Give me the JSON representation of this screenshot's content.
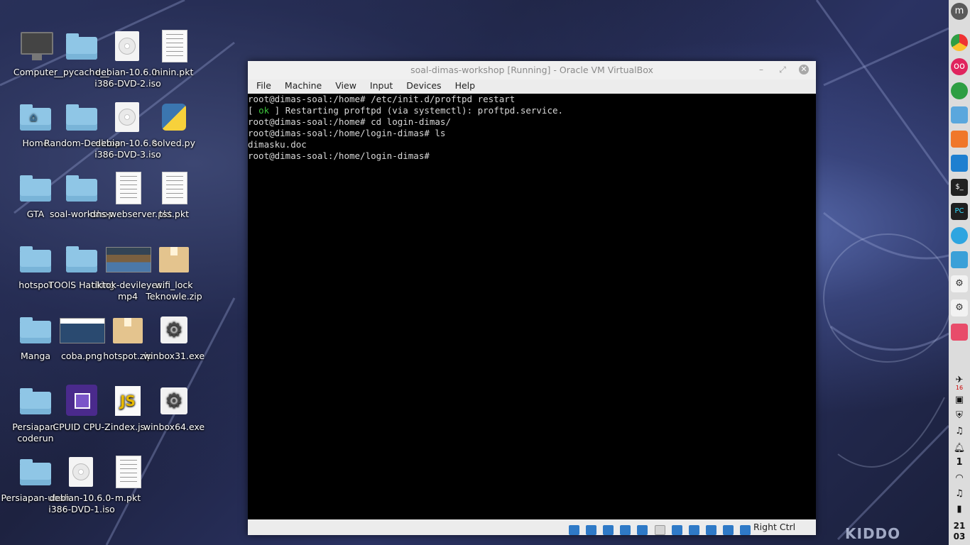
{
  "desktop": {
    "icons": [
      {
        "label": "Computer",
        "type": "computer"
      },
      {
        "label": "__pycache__",
        "type": "folder"
      },
      {
        "label": "debian-10.6.0-i386-DVD-2.iso",
        "type": "disc"
      },
      {
        "label": "ninin.pkt",
        "type": "doc"
      },
      {
        "label": "Home",
        "type": "home-folder"
      },
      {
        "label": "Random-Desktop",
        "type": "folder"
      },
      {
        "label": "debian-10.6.0-i386-DVD-3.iso",
        "type": "disc"
      },
      {
        "label": "solved.py",
        "type": "python"
      },
      {
        "label": "GTA",
        "type": "folder"
      },
      {
        "label": "soal-workshop",
        "type": "folder"
      },
      {
        "label": "dns-webserver.pkt",
        "type": "doc"
      },
      {
        "label": "tss.pkt",
        "type": "doc"
      },
      {
        "label": "hotspot",
        "type": "folder"
      },
      {
        "label": "TOOlS Hacking",
        "type": "folder"
      },
      {
        "label": "tiktok-devileyes.mp4",
        "type": "video"
      },
      {
        "label": "wifi_lock Teknowle.zip",
        "type": "zip"
      },
      {
        "label": "Manga",
        "type": "folder"
      },
      {
        "label": "coba.png",
        "type": "image"
      },
      {
        "label": "hotspot.zip",
        "type": "zip"
      },
      {
        "label": "winbox31.exe",
        "type": "exe"
      },
      {
        "label": "Persiapan-coderun",
        "type": "folder"
      },
      {
        "label": "CPUID CPU-Z",
        "type": "cpuz"
      },
      {
        "label": "index.js",
        "type": "js"
      },
      {
        "label": "winbox64.exe",
        "type": "exe"
      },
      {
        "label": "Persiapan-ubah",
        "type": "folder"
      },
      {
        "label": "debian-10.6.0-i386-DVD-1.iso",
        "type": "disc"
      },
      {
        "label": "m.pkt",
        "type": "doc"
      }
    ],
    "labels_display": {
      "computer": "Computer",
      "pycache": "__pycache__",
      "dvd2_l1": "debian-10.6.0-",
      "dvd2_l2": "i386-DVD-2.iso",
      "ninin": "ninin.pkt",
      "home": "Home",
      "random": "Random-Desktop",
      "dvd3_l1": "debian-10.6.0-",
      "dvd3_l2": "i386-DVD-3.iso",
      "solved": "solved.py",
      "gta": "GTA",
      "soal": "soal-workshop",
      "dns": "dns-webserver.pkt",
      "tss": "tss.pkt",
      "hotspot": "hotspot",
      "tools": "TOOlS Hacking",
      "tiktok_l1": "tiktok-devileyes.",
      "tiktok_l2": "mp4",
      "wifi_l1": "wifi_lock",
      "wifi_l2": "Teknowle.zip",
      "manga": "Manga",
      "coba": "coba.png",
      "hotspotzip": "hotspot.zip",
      "winbox31": "winbox31.exe",
      "coderun_l1": "Persiapan-",
      "coderun_l2": "coderun",
      "cpuz": "CPUID CPU-Z",
      "indexjs": "index.js",
      "winbox64": "winbox64.exe",
      "ubah": "Persiapan-ubah",
      "dvd1_l1": "debian-10.6.0-",
      "dvd1_l2": "i386-DVD-1.iso",
      "mpkt": "m.pkt"
    }
  },
  "window": {
    "title": "soal-dimas-workshop [Running] - Oracle VM VirtualBox",
    "controls": {
      "minimize": "–",
      "maximize": "⤢",
      "close": "✕"
    },
    "menu": [
      "File",
      "Machine",
      "View",
      "Input",
      "Devices",
      "Help"
    ],
    "terminal": {
      "lines": [
        "root@dimas-soal:/home# /etc/init.d/proftpd restart",
        "dimas-soal_ok_line",
        "root@dimas-soal:/home# cd login-dimas/",
        "root@dimas-soal:/home/login-dimas# ls",
        "dimasku.doc",
        "root@dimas-soal:/home/login-dimas# "
      ],
      "ok_prefix": "[ ",
      "ok_word": "ok",
      "ok_suffix": " ] Restarting proftpd (via systemctl): proftpd.service."
    },
    "status": {
      "host_key": "Right Ctrl"
    }
  },
  "panel": {
    "launchers": [
      "mint-menu-icon",
      "chrome-icon",
      "flickr-icon",
      "android-icon",
      "files-icon",
      "firefox-icon",
      "vscode-icon",
      "terminal-icon",
      "pycharm-icon",
      "telegram-icon",
      "monitor-icon",
      "settings-icon",
      "settings-icon",
      "photos-icon"
    ],
    "tray_badge": "16",
    "workspace": "1",
    "clock_hour": "21",
    "clock_min": "03"
  },
  "wallpaper": {
    "brand_text": "KIDDO"
  },
  "colors": {
    "terminal_bg": "#000000",
    "ok_green": "#3cc43c",
    "panel_bg": "#dcdcdc"
  }
}
